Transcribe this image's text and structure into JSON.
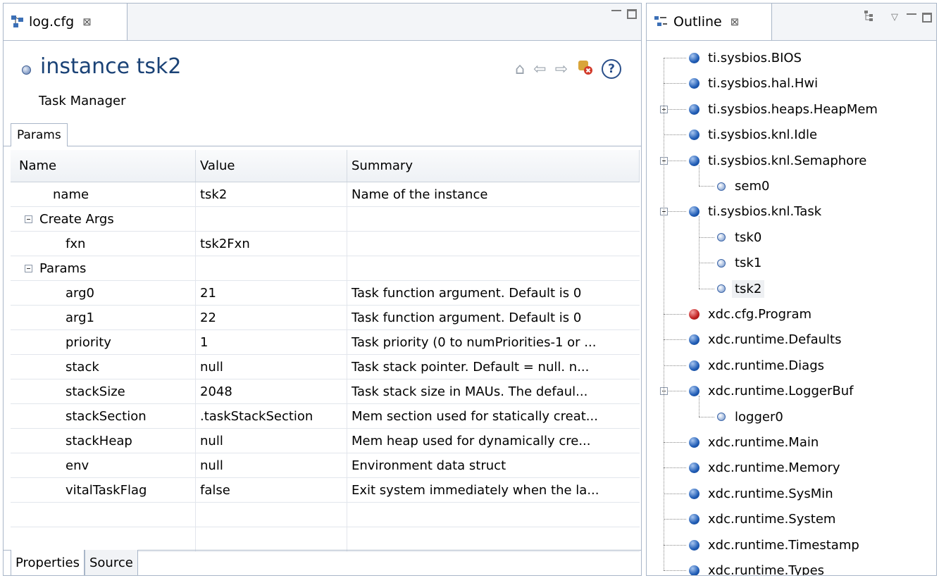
{
  "editor": {
    "tab_label": "log.cfg",
    "close_glyph": "⊠",
    "heading": "instance tsk2",
    "subtitle": "Task Manager",
    "params_tab": "Params",
    "columns": [
      "Name",
      "Value",
      "Summary"
    ],
    "rows": [
      {
        "name": "name",
        "value": "tsk2",
        "summary": "Name of the instance",
        "level": 0
      },
      {
        "name": "Create Args",
        "value": "",
        "summary": "",
        "level": -1
      },
      {
        "name": "fxn",
        "value": "tsk2Fxn",
        "summary": "",
        "level": 1
      },
      {
        "name": "Params",
        "value": "",
        "summary": "",
        "level": -1
      },
      {
        "name": "arg0",
        "value": "21",
        "summary": "Task function argument. Default is 0",
        "level": 1
      },
      {
        "name": "arg1",
        "value": "22",
        "summary": "Task function argument. Default is 0",
        "level": 1
      },
      {
        "name": "priority",
        "value": "1",
        "summary": "Task priority (0 to numPriorities-1 or ...",
        "level": 1
      },
      {
        "name": "stack",
        "value": "null",
        "summary": "Task stack pointer. Default = null.  n...",
        "level": 1
      },
      {
        "name": "stackSize",
        "value": "2048",
        "summary": "Task stack size in MAUs.   The defaul...",
        "level": 1
      },
      {
        "name": "stackSection",
        "value": ".taskStackSection",
        "summary": "Mem section used for statically creat...",
        "level": 1
      },
      {
        "name": "stackHeap",
        "value": "null",
        "summary": "Mem heap used for dynamically cre...",
        "level": 1
      },
      {
        "name": "env",
        "value": "null",
        "summary": "Environment data struct",
        "level": 1
      },
      {
        "name": "vitalTaskFlag",
        "value": "false",
        "summary": "Exit system immediately when the la...",
        "level": 1
      },
      {
        "name": "",
        "value": "",
        "summary": "",
        "level": 0
      },
      {
        "name": "",
        "value": "",
        "summary": "",
        "level": 0
      }
    ],
    "bottom_tabs": [
      "Properties",
      "Source"
    ],
    "nav_icons": [
      "home-icon",
      "back-arrow-icon",
      "forward-arrow-icon",
      "error-config-icon",
      "help-icon"
    ]
  },
  "outline": {
    "tab_label": "Outline",
    "close_glyph": "⊠",
    "items": [
      {
        "label": "ti.sysbios.BIOS",
        "depth": 0,
        "type": "module",
        "toggle": ""
      },
      {
        "label": "ti.sysbios.hal.Hwi",
        "depth": 0,
        "type": "module",
        "toggle": ""
      },
      {
        "label": "ti.sysbios.heaps.HeapMem",
        "depth": 0,
        "type": "module",
        "toggle": "plus"
      },
      {
        "label": "ti.sysbios.knl.Idle",
        "depth": 0,
        "type": "module",
        "toggle": ""
      },
      {
        "label": "ti.sysbios.knl.Semaphore",
        "depth": 0,
        "type": "module",
        "toggle": "minus"
      },
      {
        "label": "sem0",
        "depth": 1,
        "type": "instance",
        "toggle": ""
      },
      {
        "label": "ti.sysbios.knl.Task",
        "depth": 0,
        "type": "module",
        "toggle": "minus"
      },
      {
        "label": "tsk0",
        "depth": 1,
        "type": "instance",
        "toggle": ""
      },
      {
        "label": "tsk1",
        "depth": 1,
        "type": "instance",
        "toggle": ""
      },
      {
        "label": "tsk2",
        "depth": 1,
        "type": "instance",
        "toggle": "",
        "selected": true
      },
      {
        "label": "xdc.cfg.Program",
        "depth": 0,
        "type": "program",
        "toggle": ""
      },
      {
        "label": "xdc.runtime.Defaults",
        "depth": 0,
        "type": "module",
        "toggle": ""
      },
      {
        "label": "xdc.runtime.Diags",
        "depth": 0,
        "type": "module",
        "toggle": ""
      },
      {
        "label": "xdc.runtime.LoggerBuf",
        "depth": 0,
        "type": "module",
        "toggle": "minus"
      },
      {
        "label": "logger0",
        "depth": 1,
        "type": "instance",
        "toggle": ""
      },
      {
        "label": "xdc.runtime.Main",
        "depth": 0,
        "type": "module",
        "toggle": ""
      },
      {
        "label": "xdc.runtime.Memory",
        "depth": 0,
        "type": "module",
        "toggle": ""
      },
      {
        "label": "xdc.runtime.SysMin",
        "depth": 0,
        "type": "module",
        "toggle": ""
      },
      {
        "label": "xdc.runtime.System",
        "depth": 0,
        "type": "module",
        "toggle": ""
      },
      {
        "label": "xdc.runtime.Timestamp",
        "depth": 0,
        "type": "module",
        "toggle": ""
      },
      {
        "label": "xdc.runtime.Types",
        "depth": 0,
        "type": "module",
        "toggle": ""
      }
    ]
  },
  "colors": {
    "heading": "#1a4276",
    "border": "#a9b6c8",
    "module_ball": "#1f5cb5",
    "program_ball": "#c02020"
  }
}
